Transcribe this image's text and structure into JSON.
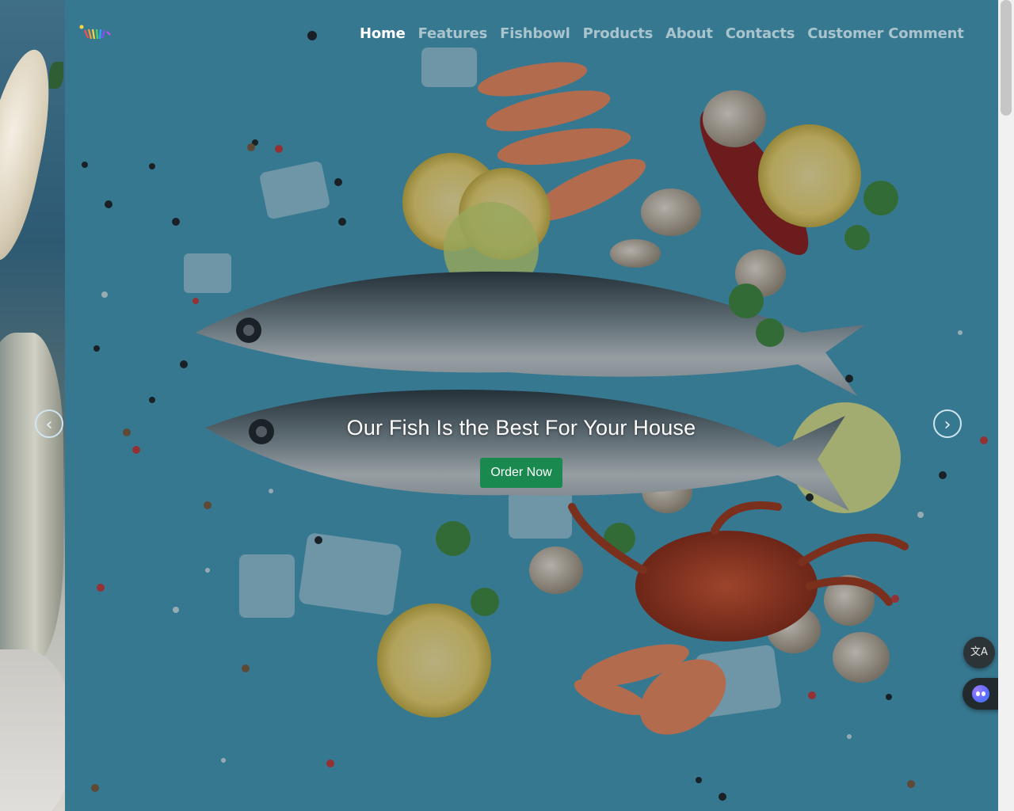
{
  "nav": {
    "items": [
      {
        "label": "Home",
        "active": true
      },
      {
        "label": "Features",
        "active": false
      },
      {
        "label": "Fishbowl",
        "active": false
      },
      {
        "label": "Products",
        "active": false
      },
      {
        "label": "About",
        "active": false
      },
      {
        "label": "Contacts",
        "active": false
      },
      {
        "label": "Customer Comment",
        "active": false
      }
    ]
  },
  "hero": {
    "title": "Our Fish Is the Best For Your House",
    "cta_label": "Order Now",
    "prev_glyph": "‹",
    "next_glyph": "›"
  },
  "widgets": {
    "translate_glyph": "文A"
  },
  "colors": {
    "nav_active": "#ffffff",
    "nav_inactive": "#a9c4cd",
    "cta_bg": "#19894f",
    "hero_bg": "#3e93b0"
  },
  "icons": [
    "logo-icon",
    "chevron-left-icon",
    "chevron-right-icon",
    "translate-icon",
    "assistant-bot-icon"
  ]
}
